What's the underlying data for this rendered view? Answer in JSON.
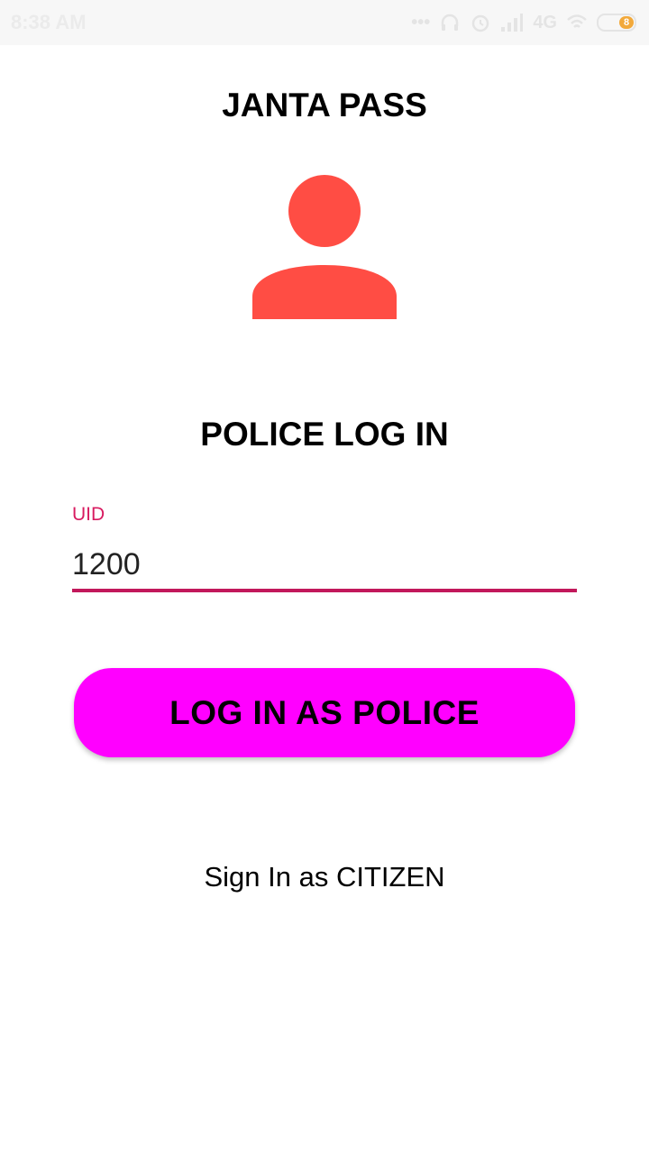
{
  "status_bar": {
    "time": "8:38 AM",
    "network": "4G",
    "battery_level": "8",
    "icons": [
      "dots-icon",
      "headphones-icon",
      "alarm-icon",
      "signal-icon",
      "network-4g-icon",
      "wifi-icon",
      "battery-icon"
    ]
  },
  "app": {
    "title": "JANTA PASS"
  },
  "avatar": {
    "icon": "person-icon",
    "color": "#ff4d44"
  },
  "login": {
    "heading": "POLICE LOG IN",
    "uid_label": "UID",
    "uid_value": "1200",
    "submit_label": "LOG IN AS POLICE",
    "switch_label": "Sign In as CITIZEN"
  },
  "colors": {
    "accent": "#d81b60",
    "button": "#ff00ff",
    "avatar": "#ff4d44"
  }
}
